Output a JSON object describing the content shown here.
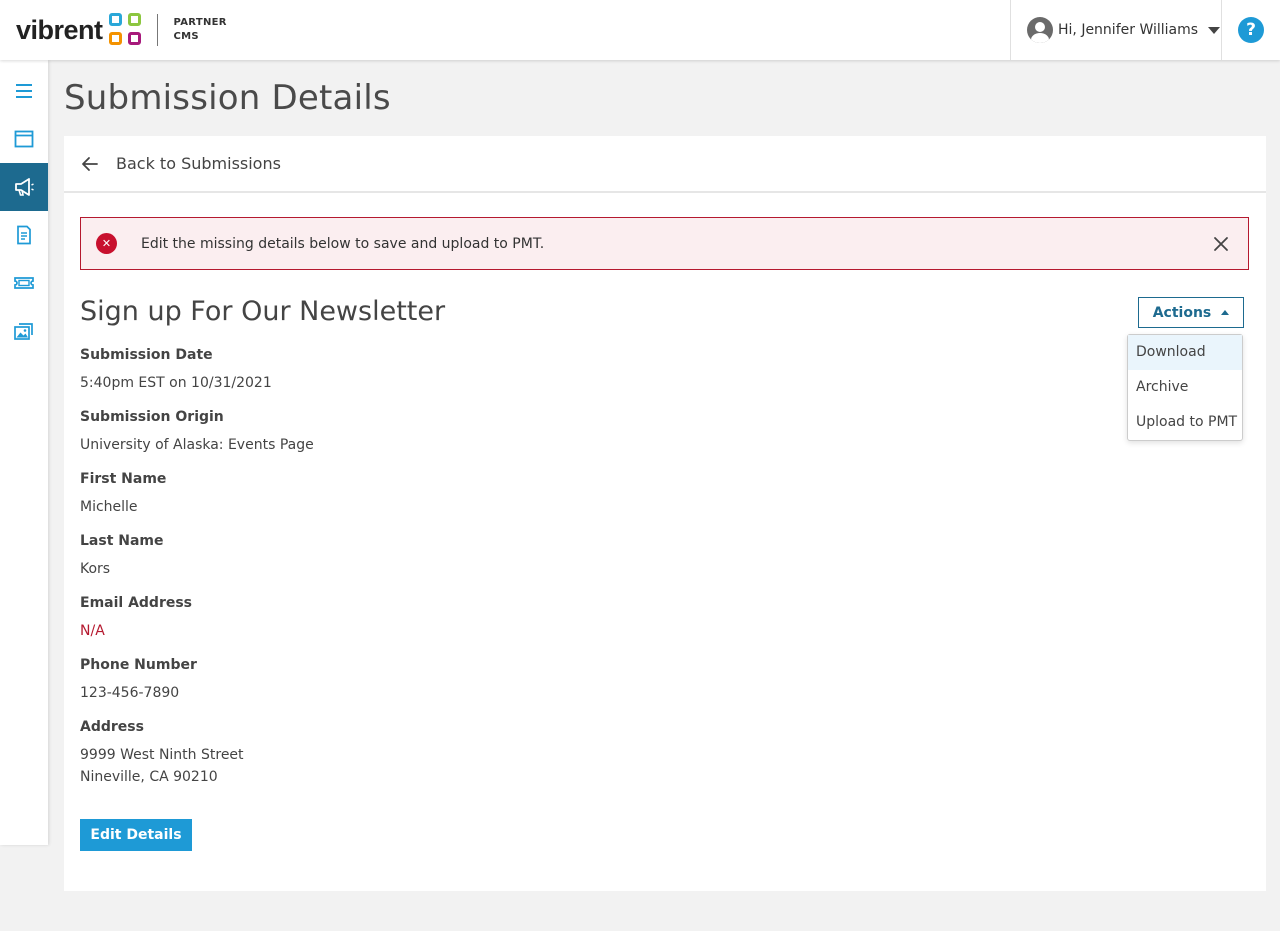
{
  "header": {
    "logo_word": "vibrent",
    "logo_sub_line1": "PARTNER",
    "logo_sub_line2": "CMS",
    "user_greeting": "Hi, Jennifer Williams",
    "help_label": "?"
  },
  "sidebar": {
    "items": [
      {
        "icon": "hamburger-menu-icon"
      },
      {
        "icon": "browser-window-icon"
      },
      {
        "icon": "megaphone-icon",
        "active": true
      },
      {
        "icon": "document-icon"
      },
      {
        "icon": "ticket-icon"
      },
      {
        "icon": "gallery-icon"
      }
    ]
  },
  "page": {
    "title": "Submission Details",
    "back_label": "Back to Submissions"
  },
  "alert": {
    "icon": "error-x-icon",
    "text": "Edit the missing details below to save and upload to PMT.",
    "close_icon": "close-icon"
  },
  "form": {
    "title": "Sign up For Our Newsletter",
    "actions_label": "Actions",
    "actions_menu": [
      "Download",
      "Archive",
      "Upload to PMT"
    ],
    "fields": [
      {
        "label": "Submission Date",
        "value": "5:40pm EST on 10/31/2021"
      },
      {
        "label": "Submission Origin",
        "value": "University of Alaska: Events Page"
      },
      {
        "label": "First Name",
        "value": "Michelle"
      },
      {
        "label": "Last Name",
        "value": "Kors"
      },
      {
        "label": "Email Address",
        "value": "N/A",
        "missing": true
      },
      {
        "label": "Phone Number",
        "value": "123-456-7890"
      },
      {
        "label": "Address",
        "value_line1": "9999 West Ninth Street",
        "value_line2": "Nineville, CA 90210"
      }
    ],
    "edit_label": "Edit Details"
  },
  "colors": {
    "brand": "#1d6a8f",
    "accent": "#1e9ad6",
    "error": "#b5192f"
  }
}
